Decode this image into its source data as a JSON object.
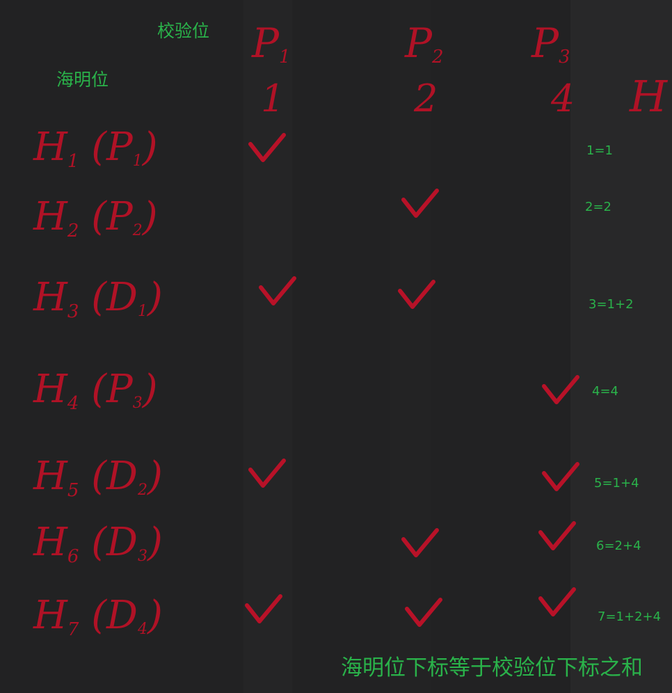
{
  "labels": {
    "check_bits": "校验位",
    "hamming_bits": "海明位",
    "caption": "海明位下标等于校验位下标之和"
  },
  "columns": [
    {
      "name": "P1",
      "weight": "1"
    },
    {
      "name": "P2",
      "weight": "2"
    },
    {
      "name": "P3",
      "weight": "4"
    }
  ],
  "extra_column_header": "H",
  "rows": [
    {
      "label": "H1(P1)",
      "checks": [
        true,
        false,
        false
      ],
      "note": "1=1"
    },
    {
      "label": "H2(P2)",
      "checks": [
        false,
        true,
        false
      ],
      "note": "2=2"
    },
    {
      "label": "H3(D1)",
      "checks": [
        true,
        true,
        false
      ],
      "note": "3=1+2"
    },
    {
      "label": "H4(P3)",
      "checks": [
        false,
        false,
        true
      ],
      "note": "4=4"
    },
    {
      "label": "H5(D2)",
      "checks": [
        true,
        false,
        true
      ],
      "note": "5=1+4"
    },
    {
      "label": "H6(D3)",
      "checks": [
        false,
        true,
        true
      ],
      "note": "6=2+4"
    },
    {
      "label": "H7(D4)",
      "checks": [
        true,
        true,
        true
      ],
      "note": "7=1+2+4"
    }
  ],
  "colors": {
    "background": "#222223",
    "ink_red": "#b81228",
    "annotation_green": "#2ab24a"
  }
}
